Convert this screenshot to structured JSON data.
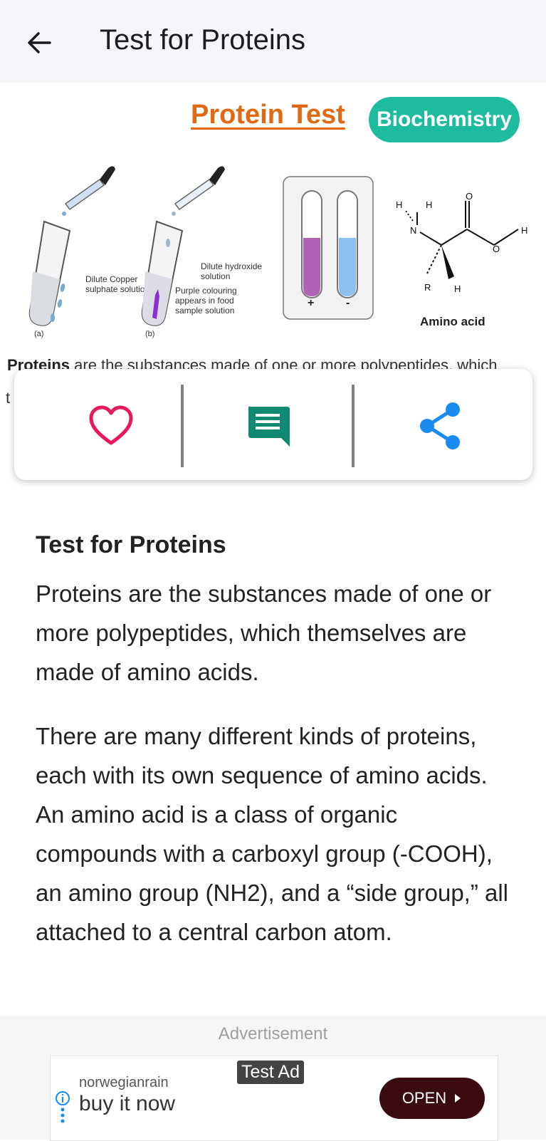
{
  "appbar": {
    "title": "Test for Proteins",
    "back_icon": "arrow-left-icon"
  },
  "hero": {
    "title": "Protein Test",
    "tag": "Biochemistry",
    "figure": {
      "label_a_reagent": [
        "Dilute Copper",
        "sulphate solution"
      ],
      "label_b_reagent": [
        "Dilute hydroxide",
        "solution"
      ],
      "label_purple": [
        "Purple colouring",
        "appears in food",
        "sample solution"
      ],
      "fig_a": "(a)",
      "fig_b": "(b)",
      "plus": "+",
      "minus": "-",
      "amino_caption": "Amino acid",
      "atom_h": "H",
      "atom_n": "N",
      "atom_o": "O",
      "atom_r": "R"
    }
  },
  "cut_text": {
    "bold": "Proteins",
    "rest": " are the substances made of one or more polypeptides, which",
    "peek": "t"
  },
  "actions": {
    "like_icon": "heart-icon",
    "comment_icon": "comment-icon",
    "share_icon": "share-icon",
    "colors": {
      "like": "#e8185a",
      "comment": "#0f8a70",
      "share": "#1a8cf0"
    }
  },
  "article": {
    "title": "Test for Proteins",
    "paragraphs": [
      "Proteins are the substances made of one or more polypeptides, which themselves are made of amino acids.",
      "There are many different kinds of proteins, each with its own sequence of amino acids. An amino acid is a class of organic compounds with a carboxyl group (-COOH), an amino group (NH2), and a “side group,” all attached to a central carbon atom."
    ]
  },
  "ad": {
    "label": "Advertisement",
    "badge": "Test Ad",
    "advertiser": "norwegianrain",
    "headline": "buy it now",
    "cta": "OPEN",
    "info_icon": "info-icon"
  }
}
